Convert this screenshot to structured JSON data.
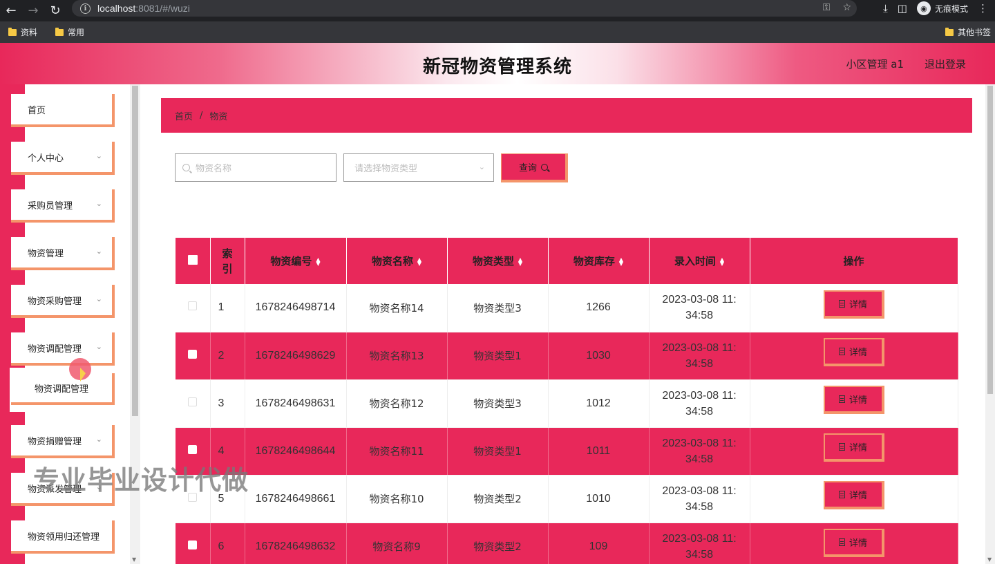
{
  "browser": {
    "url_host": "localhost",
    "url_rest": ":8081/#/wuzi",
    "profile_label": "无痕模式",
    "bookmarks": [
      "资料",
      "常用"
    ],
    "other_bookmarks": "其他书签"
  },
  "header": {
    "title": "新冠物资管理系统",
    "user": "小区管理 a1",
    "logout": "退出登录"
  },
  "sidebar": {
    "items": [
      {
        "label": "首页",
        "has_chevron": false
      },
      {
        "label": "个人中心",
        "has_chevron": true
      },
      {
        "label": "采购员管理",
        "has_chevron": true
      },
      {
        "label": "物资管理",
        "has_chevron": true
      },
      {
        "label": "物资采购管理",
        "has_chevron": true
      },
      {
        "label": "物资调配管理",
        "has_chevron": true
      },
      {
        "label": "物资捐赠管理",
        "has_chevron": true
      },
      {
        "label": "物资派发管理",
        "has_chevron": true
      },
      {
        "label": "物资领用归还管理",
        "has_chevron": false
      }
    ],
    "submenu": {
      "label": "物资调配管理"
    }
  },
  "breadcrumb": {
    "home": "首页",
    "separator": "/",
    "current": "物资"
  },
  "search": {
    "name_placeholder": "物资名称",
    "type_placeholder": "请选择物资类型",
    "query_label": "查询"
  },
  "table": {
    "headers": {
      "index": "索引",
      "code": "物资编号",
      "name": "物资名称",
      "type": "物资类型",
      "stock": "物资库存",
      "time": "录入时间",
      "action": "操作"
    },
    "detail_label": "详情",
    "rows": [
      {
        "index": "1",
        "code": "1678246498714",
        "name": "物资名称14",
        "type": "物资类型3",
        "stock": "1266",
        "time_a": "2023-03-08 11:",
        "time_b": "34:58"
      },
      {
        "index": "2",
        "code": "1678246498629",
        "name": "物资名称13",
        "type": "物资类型1",
        "stock": "1030",
        "time_a": "2023-03-08 11:",
        "time_b": "34:58"
      },
      {
        "index": "3",
        "code": "1678246498631",
        "name": "物资名称12",
        "type": "物资类型3",
        "stock": "1012",
        "time_a": "2023-03-08 11:",
        "time_b": "34:58"
      },
      {
        "index": "4",
        "code": "1678246498644",
        "name": "物资名称11",
        "type": "物资类型1",
        "stock": "1011",
        "time_a": "2023-03-08 11:",
        "time_b": "34:58"
      },
      {
        "index": "5",
        "code": "1678246498661",
        "name": "物资名称10",
        "type": "物资类型2",
        "stock": "1010",
        "time_a": "2023-03-08 11:",
        "time_b": "34:58"
      },
      {
        "index": "6",
        "code": "1678246498632",
        "name": "物资名称9",
        "type": "物资类型2",
        "stock": "109",
        "time_a": "2023-03-08 11:",
        "time_b": "34:58"
      }
    ]
  },
  "watermark": "专业毕业设计代做",
  "colors": {
    "accent": "#e8285a",
    "border_accent": "#f4956a"
  }
}
